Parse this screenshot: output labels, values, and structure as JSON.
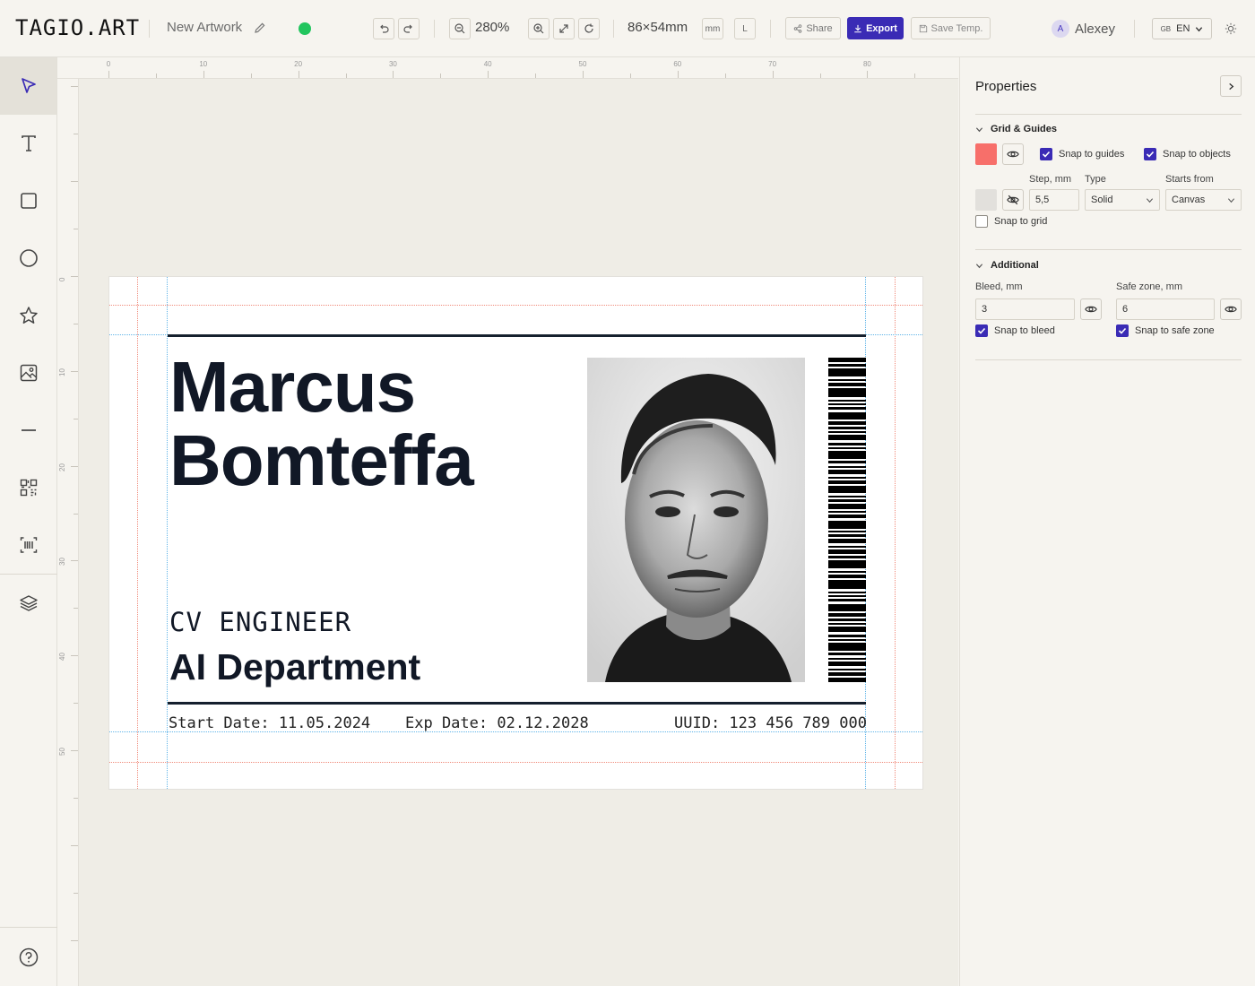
{
  "app": {
    "logo": "TAGIO.ART",
    "artwork_name": "New Artwork"
  },
  "toolbar": {
    "zoom": "280%",
    "dimensions": "86×54mm",
    "unit": "mm",
    "orientation": "L",
    "share_label": "Share",
    "export_label": "Export",
    "save_template_label": "Save Temp.",
    "status_color": "#22c55e"
  },
  "user": {
    "avatar_initial": "A",
    "name": "Alexey"
  },
  "language": {
    "flag": "GB",
    "code": "EN"
  },
  "tools": [
    "select-tool",
    "text-tool",
    "rectangle-tool",
    "ellipse-tool",
    "star-tool",
    "image-tool",
    "line-tool",
    "qr-code-tool",
    "barcode-tool",
    "layers-tool",
    "help-tool"
  ],
  "rulers": {
    "top_labels": [
      "0",
      "10",
      "20",
      "30",
      "40",
      "50",
      "60",
      "70",
      "80"
    ],
    "left_labels": [
      "0",
      "10",
      "20",
      "30",
      "40",
      "50"
    ]
  },
  "card": {
    "first_name": "Marcus",
    "last_name": "Bomteffa",
    "role": "CV ENGINEER",
    "department": "AI Department",
    "start_date": "Start Date: 11.05.2024",
    "exp_date": "Exp Date: 02.12.2028",
    "uuid": "UUID: 123 456 789 000"
  },
  "properties": {
    "title": "Properties",
    "grid_guides": {
      "heading": "Grid & Guides",
      "guide_color": "#f76f6a",
      "snap_to_guides_label": "Snap to guides",
      "snap_to_guides": true,
      "snap_to_objects_label": "Snap to objects",
      "snap_to_objects": true,
      "grid_color": "#e2e0dc",
      "step_label": "Step, mm",
      "step_value": "5,5",
      "type_label": "Type",
      "type_value": "Solid",
      "starts_from_label": "Starts from",
      "starts_from_value": "Canvas",
      "snap_to_grid_label": "Snap to grid",
      "snap_to_grid": false
    },
    "additional": {
      "heading": "Additional",
      "bleed_label": "Bleed, mm",
      "bleed_value": "3",
      "safe_zone_label": "Safe zone, mm",
      "safe_zone_value": "6",
      "snap_to_bleed_label": "Snap to bleed",
      "snap_to_bleed": true,
      "snap_to_safe_zone_label": "Snap to safe zone",
      "snap_to_safe_zone": true
    }
  }
}
